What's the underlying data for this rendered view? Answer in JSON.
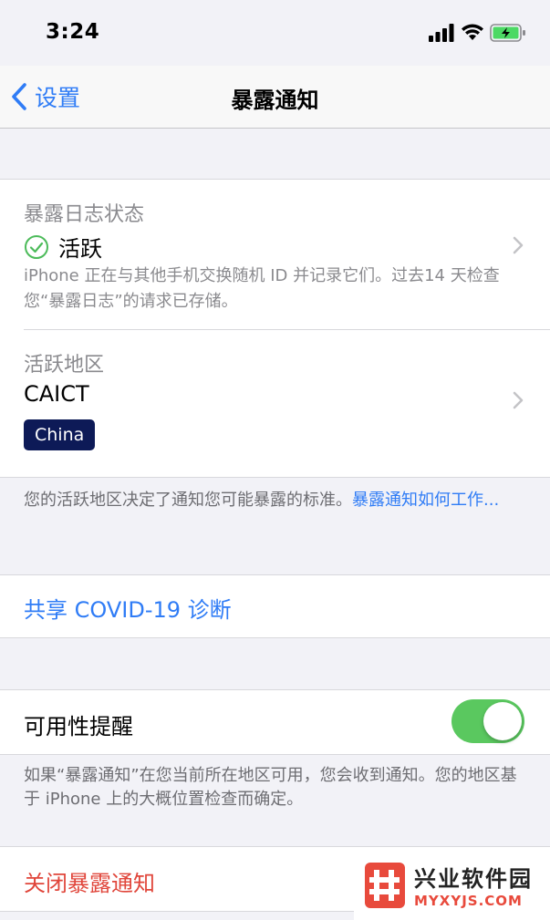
{
  "status_bar": {
    "time": "3:24",
    "signal_icon": "signal-icon",
    "wifi_icon": "wifi-icon",
    "battery_icon": "battery-charging-icon"
  },
  "nav": {
    "back_label": "设置",
    "title": "暴露通知"
  },
  "log_status": {
    "header": "暴露日志状态",
    "status": "活跃",
    "status_icon": "check-circle-icon",
    "description": "iPhone 正在与其他手机交换随机 ID 并记录它们。过去14 天检查您“暴露日志”的请求已存储。"
  },
  "active_region": {
    "header": "活跃地区",
    "name": "CAICT",
    "chip": "China",
    "footer_text": "您的活跃地区决定了通知您可能暴露的标准。",
    "footer_link": "暴露通知如何工作..."
  },
  "share": {
    "label": "共享 COVID-19 诊断"
  },
  "availability": {
    "label": "可用性提醒",
    "enabled": true,
    "footer": "如果“暴露通知”在您当前所在地区可用，您会收到通知。您的地区基于 iPhone 上的大概位置检查而确定。"
  },
  "turn_off": {
    "label": "关闭暴露通知"
  },
  "watermark": {
    "cn": "兴业软件园",
    "en": "MYXYJS.COM"
  },
  "colors": {
    "accent": "#2f7cf6",
    "destructive": "#e0453a",
    "toggle_on": "#5ac85f",
    "chip_bg": "#0d1a57",
    "background": "#f2f2f7"
  }
}
